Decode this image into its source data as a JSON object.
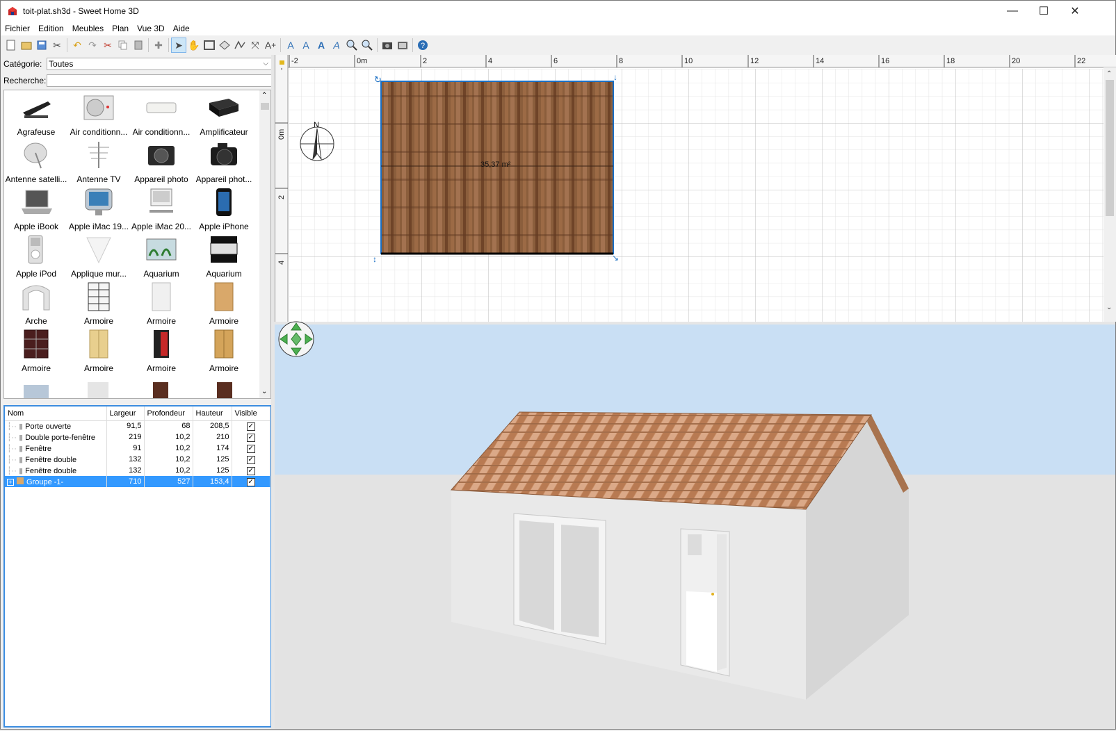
{
  "window": {
    "title": "toit-plat.sh3d - Sweet Home 3D",
    "controls": {
      "minimize": "—",
      "maximize": "☐",
      "close": "✕"
    }
  },
  "menu": [
    "Fichier",
    "Edition",
    "Meubles",
    "Plan",
    "Vue 3D",
    "Aide"
  ],
  "catalog": {
    "category_label": "Catégorie:",
    "category_value": "Toutes",
    "search_label": "Recherche:",
    "search_value": "",
    "items": [
      "Agrafeuse",
      "Air conditionn...",
      "Air conditionn...",
      "Amplificateur",
      "Antenne satelli...",
      "Antenne TV",
      "Appareil photo",
      "Appareil phot...",
      "Apple iBook",
      "Apple iMac 19...",
      "Apple iMac 20...",
      "Apple iPhone",
      "Apple iPod",
      "Applique mur...",
      "Aquarium",
      "Aquarium",
      "Arche",
      "Armoire",
      "Armoire",
      "Armoire",
      "Armoire",
      "Armoire",
      "Armoire",
      "Armoire"
    ]
  },
  "furniture": {
    "columns": [
      "Nom",
      "Largeur",
      "Profondeur",
      "Hauteur",
      "Visible"
    ],
    "rows": [
      {
        "name": "Porte ouverte",
        "w": "91,5",
        "d": "68",
        "h": "208,5",
        "visible": true
      },
      {
        "name": "Double porte-fenêtre",
        "w": "219",
        "d": "10,2",
        "h": "210",
        "visible": true
      },
      {
        "name": "Fenêtre",
        "w": "91",
        "d": "10,2",
        "h": "174",
        "visible": true
      },
      {
        "name": "Fenêtre double",
        "w": "132",
        "d": "10,2",
        "h": "125",
        "visible": true
      },
      {
        "name": "Fenêtre double",
        "w": "132",
        "d": "10,2",
        "h": "125",
        "visible": true
      },
      {
        "name": "Groupe -1-",
        "w": "710",
        "d": "527",
        "h": "153,4",
        "visible": true,
        "selected": true,
        "expander": "+"
      }
    ]
  },
  "plan": {
    "ruler_x": [
      "-2",
      "0m",
      "2",
      "4",
      "6",
      "8",
      "10",
      "12",
      "14",
      "16",
      "18",
      "20",
      "22"
    ],
    "ruler_y": [
      "-",
      "0m",
      "2",
      "4"
    ],
    "room_area": "35,37 m²",
    "compass_label": "N"
  }
}
